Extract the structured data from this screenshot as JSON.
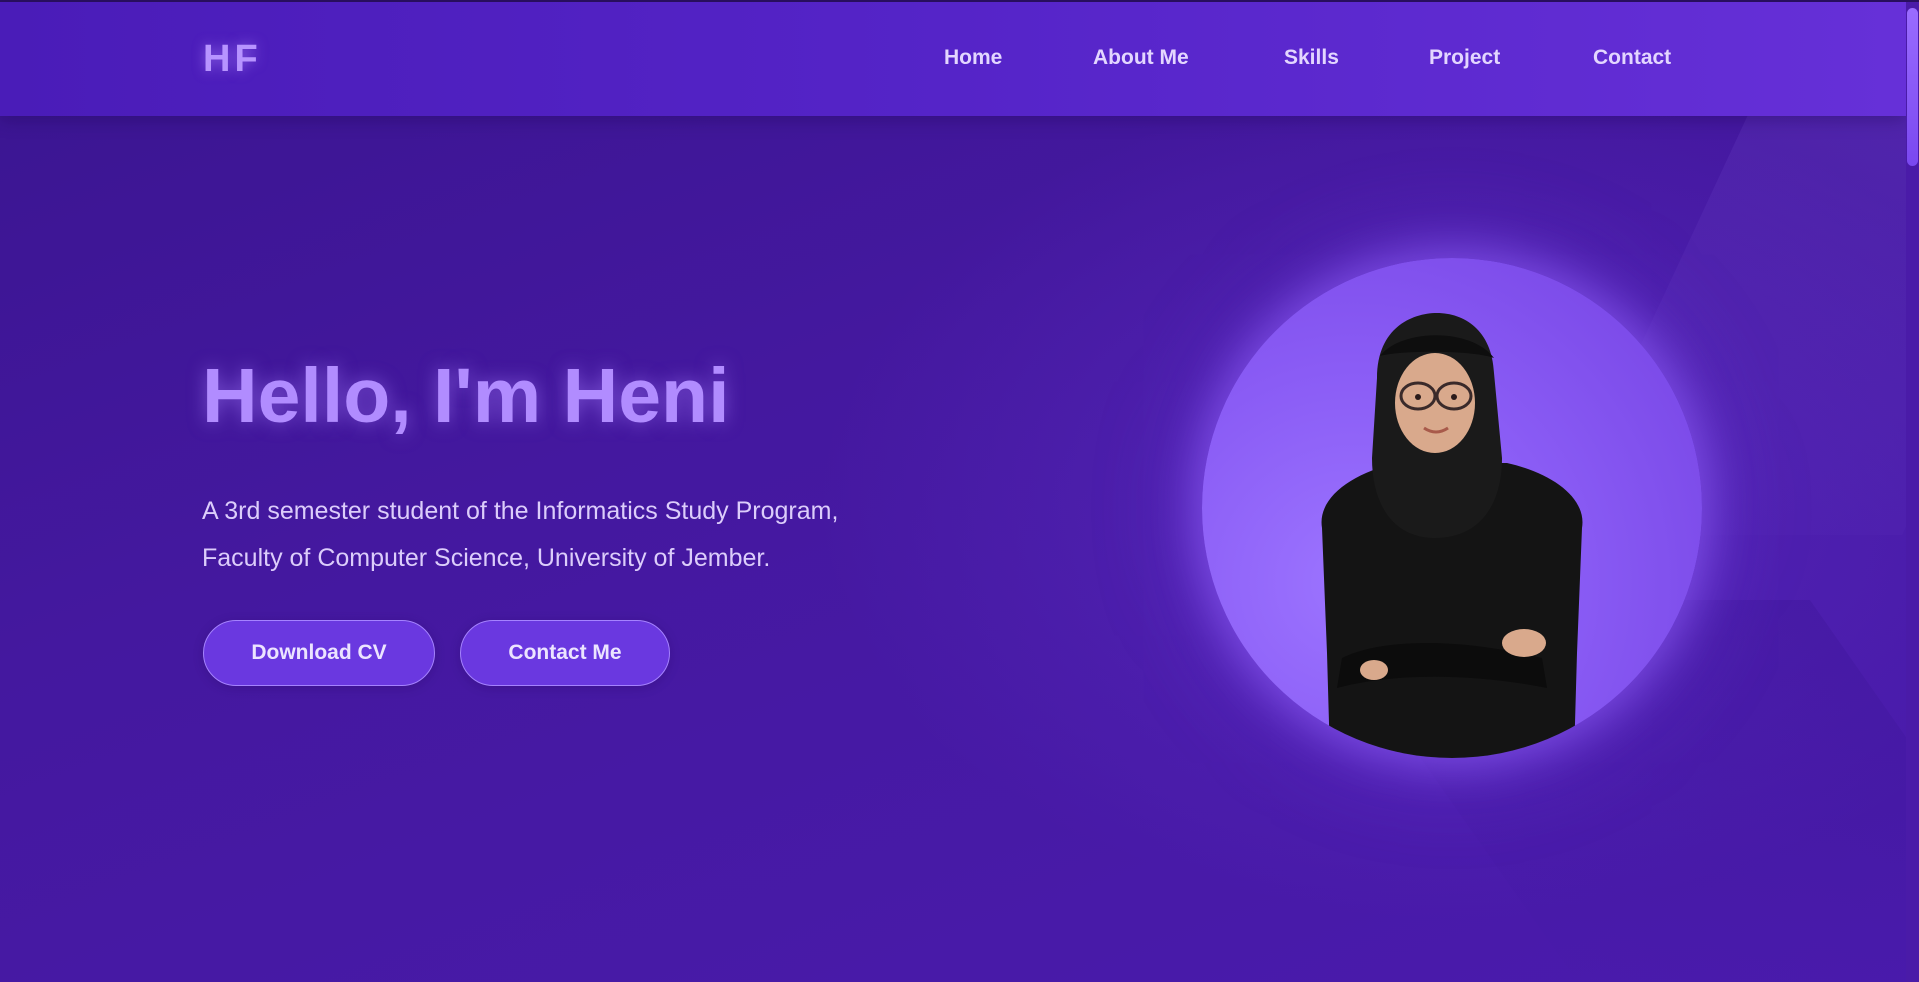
{
  "header": {
    "logo": "HF",
    "nav": [
      {
        "label": "Home"
      },
      {
        "label": "About Me"
      },
      {
        "label": "Skills"
      },
      {
        "label": "Project"
      },
      {
        "label": "Contact"
      }
    ]
  },
  "hero": {
    "title": "Hello, I'm Heni",
    "description_line1": "A 3rd semester student of the Informatics Study Program,",
    "description_line2": "Faculty of Computer Science, University of Jember.",
    "buttons": {
      "download_cv": "Download CV",
      "contact_me": "Contact Me"
    },
    "avatar_icon": "profile-photo"
  },
  "colors": {
    "background": "#4a1ba8",
    "navbar": "#5524c8",
    "accent": "#b18cff",
    "button": "#6a38e0"
  }
}
